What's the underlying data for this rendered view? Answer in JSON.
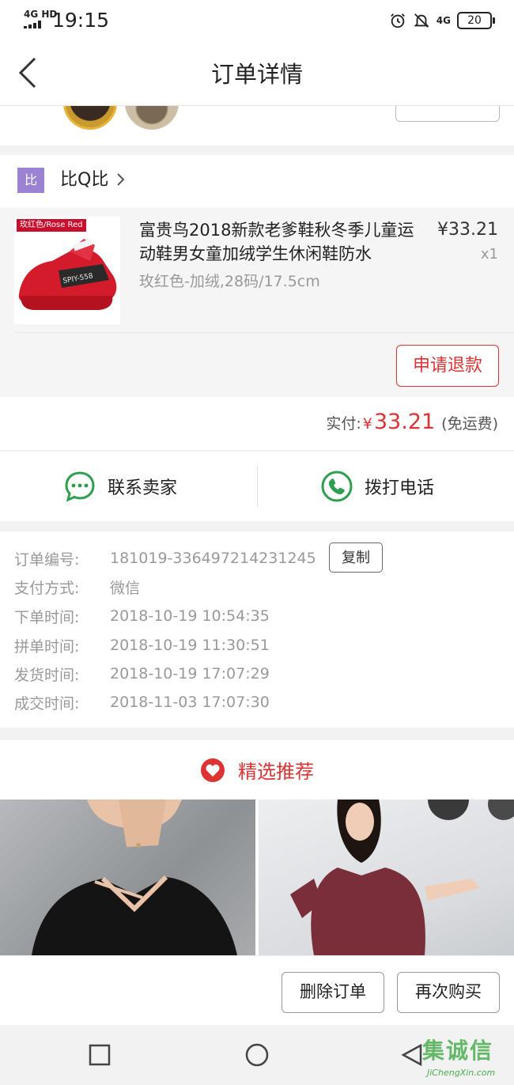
{
  "status_bar": {
    "network": "4G HD",
    "time": "19:15",
    "lte": "4G",
    "battery": "20"
  },
  "header": {
    "title": "订单详情"
  },
  "shop": {
    "logo_text": "比",
    "name": "比Q比"
  },
  "product": {
    "image_tag": "玫红色/Rose Red",
    "name": "富贵鸟2018新款老爹鞋秋冬季儿童运动鞋男女童加绒学生休闲鞋防水",
    "price": "¥33.21",
    "quantity": "x1",
    "spec": "玫红色-加绒,28码/17.5cm",
    "refund_label": "申请退款"
  },
  "payment": {
    "label": "实付:",
    "currency": "¥",
    "amount": "33.21",
    "shipping": "(免运费)"
  },
  "contact": {
    "seller_label": "联系卖家",
    "call_label": "拨打电话"
  },
  "order_info": {
    "copy_label": "复制",
    "rows": [
      {
        "key": "订单编号:",
        "value": "181019-336497214231245"
      },
      {
        "key": "支付方式:",
        "value": "微信"
      },
      {
        "key": "下单时间:",
        "value": "2018-10-19 10:54:35"
      },
      {
        "key": "拼单时间:",
        "value": "2018-10-19 11:30:51"
      },
      {
        "key": "发货时间:",
        "value": "2018-10-19 17:07:29"
      },
      {
        "key": "成交时间:",
        "value": "2018-11-03 17:07:30"
      }
    ]
  },
  "recommend": {
    "title": "精选推荐"
  },
  "actions": {
    "delete_label": "删除订单",
    "rebuy_label": "再次购买"
  },
  "watermark": {
    "cn": "集诚信",
    "en": "JiChengXin.com"
  },
  "colors": {
    "accent": "#dd3333",
    "wechat_green": "#2e9e4f",
    "shop_logo": "#9b83d1"
  }
}
